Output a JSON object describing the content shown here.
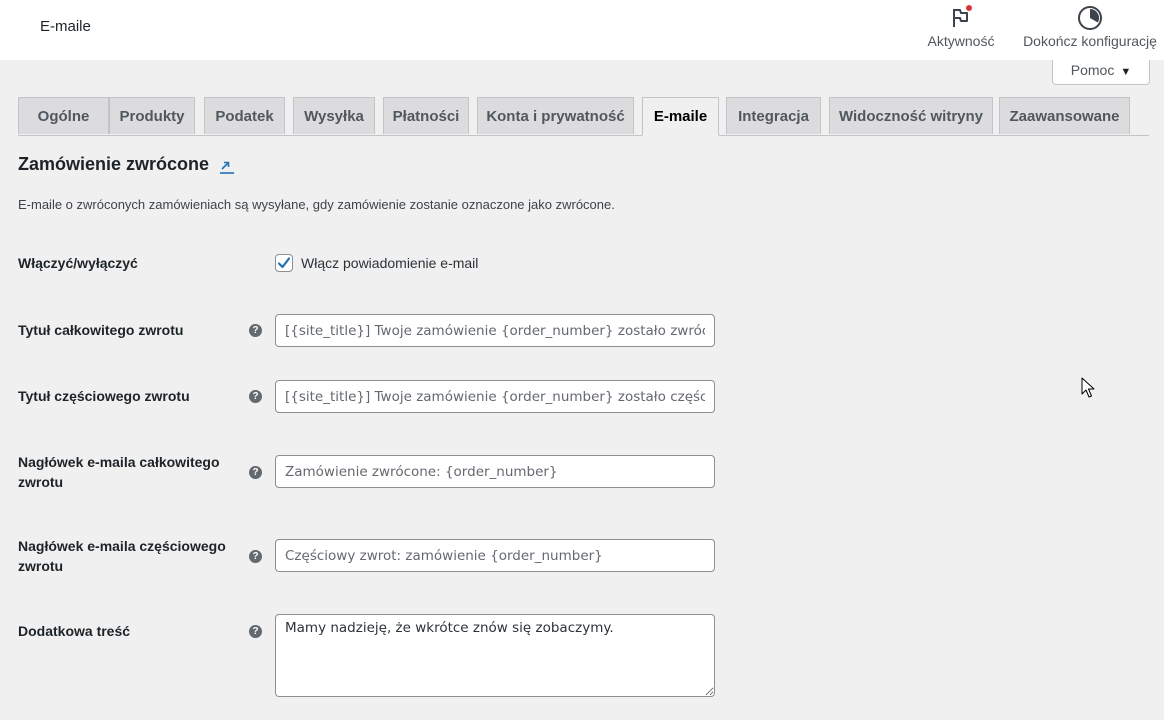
{
  "header": {
    "page_title": "E-maile",
    "activity_label": "Aktywność",
    "finish_setup_label": "Dokończ konfigurację"
  },
  "help": {
    "label": "Pomoc",
    "caret": "▼"
  },
  "tabs": [
    {
      "label": "Ogólne",
      "active": false
    },
    {
      "label": "Produkty",
      "active": false
    },
    {
      "label": "Podatek",
      "active": false
    },
    {
      "label": "Wysyłka",
      "active": false
    },
    {
      "label": "Płatności",
      "active": false
    },
    {
      "label": "Konta i prywatność",
      "active": false
    },
    {
      "label": "E-maile",
      "active": true
    },
    {
      "label": "Integracja",
      "active": false
    },
    {
      "label": "Widoczność witryny",
      "active": false
    },
    {
      "label": "Zaawansowane",
      "active": false
    }
  ],
  "section": {
    "title": "Zamówienie zwrócone",
    "description": "E-maile o zwróconych zamówieniach są wysyłane, gdy zamówienie zostanie oznaczone jako zwrócone."
  },
  "fields": {
    "enable": {
      "label": "Włączyć/wyłączyć",
      "checkbox_label": "Włącz powiadomienie e-mail",
      "checked": true
    },
    "full_refund_subject": {
      "label": "Tytuł całkowitego zwrotu",
      "placeholder": "[{site_title}] Twoje zamówienie {order_number} zostało zwrócone"
    },
    "partial_refund_subject": {
      "label": "Tytuł częściowego zwrotu",
      "placeholder": "[{site_title}] Twoje zamówienie {order_number} zostało częściowo zwrócone"
    },
    "full_refund_heading": {
      "label": "Nagłówek e-maila całkowitego zwrotu",
      "placeholder": "Zamówienie zwrócone: {order_number}"
    },
    "partial_refund_heading": {
      "label": "Nagłówek e-maila częściowego zwrotu",
      "placeholder": "Częściowy zwrot: zamówienie {order_number}"
    },
    "additional_content": {
      "label": "Dodatkowa treść",
      "value": "Mamy nadzieję, że wkrótce znów się zobaczymy."
    }
  },
  "colors": {
    "accent": "#2271b1",
    "notification_dot": "#d63638",
    "active_tab_bg": "#f0f0f1",
    "inactive_tab_bg": "#dcdcde"
  },
  "icons": {
    "activity": "flag-icon",
    "finish_setup": "progress-circle-icon",
    "back_link": "back-arrow-icon",
    "help": "help-question-icon",
    "cursor": "mouse-pointer-icon"
  }
}
